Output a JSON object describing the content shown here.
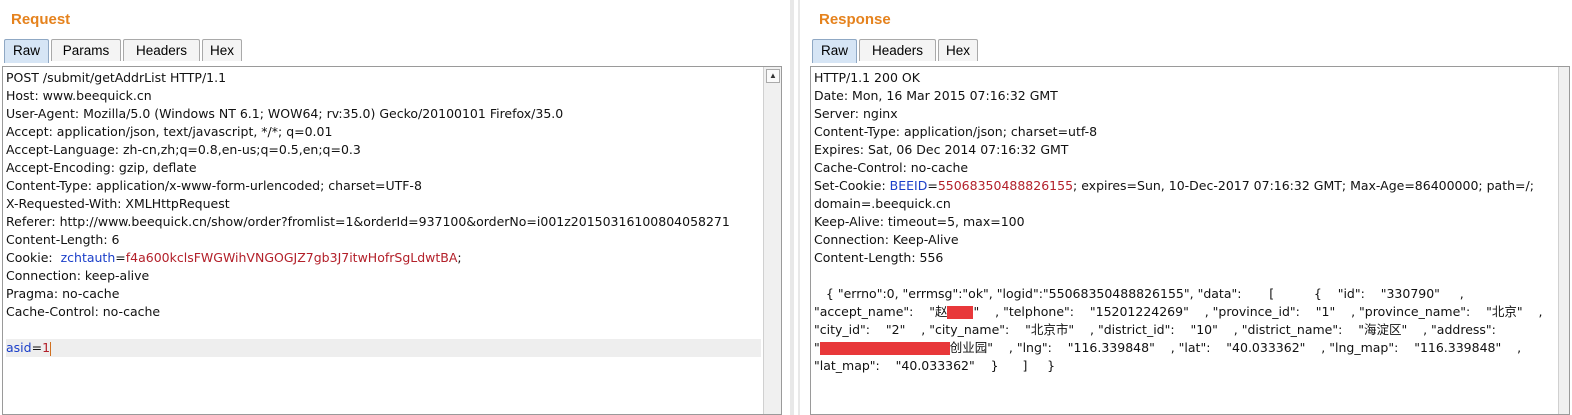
{
  "request": {
    "title": "Request",
    "tabs": [
      "Raw",
      "Params",
      "Headers",
      "Hex"
    ],
    "lines": [
      "POST /submit/getAddrList HTTP/1.1",
      "Host: www.beequick.cn",
      "User-Agent: Mozilla/5.0 (Windows NT 6.1; WOW64; rv:35.0) Gecko/20100101 Firefox/35.0",
      "Accept: application/json, text/javascript, */*; q=0.01",
      "Accept-Language: zh-cn,zh;q=0.8,en-us;q=0.5,en;q=0.3",
      "Accept-Encoding: gzip, deflate",
      "Content-Type: application/x-www-form-urlencoded; charset=UTF-8",
      "X-Requested-With: XMLHttpRequest",
      "Referer: http://www.beequick.cn/show/order?fromlist=1&orderId=937100&orderNo=i001z20150316100804058271",
      "Content-Length: 6"
    ],
    "cookie_prefix": "Cookie:  ",
    "cookie_name": "zchtauth",
    "cookie_eq": "=",
    "cookie_value": "f4a600kclsFWGWihVNGOGJZ7gb3J7itwHofrSgLdwtBA",
    "cookie_suffix": ";",
    "lines2": [
      "Connection: keep-alive",
      "Pragma: no-cache",
      "Cache-Control: no-cache"
    ],
    "body_name": "asid",
    "body_eq": "=",
    "body_value": "1"
  },
  "response": {
    "title": "Response",
    "tabs": [
      "Raw",
      "Headers",
      "Hex"
    ],
    "lines": [
      "HTTP/1.1 200 OK",
      "Date: Mon, 16 Mar 2015 07:16:32 GMT",
      "Server: nginx",
      "Content-Type: application/json; charset=utf-8",
      "Expires: Sat, 06 Dec 2014 07:16:32 GMT",
      "Cache-Control: no-cache"
    ],
    "setcookie_prefix": "Set-Cookie: ",
    "setcookie_name": "BEEID",
    "setcookie_eq": "=",
    "setcookie_value": "55068350488826155",
    "setcookie_rest": "; expires=Sun, 10-Dec-2017 07:16:32 GMT; Max-Age=86400000; path=/;",
    "lines2": [
      "domain=.beequick.cn",
      "Keep-Alive: timeout=5, max=100",
      "Connection: Keep-Alive",
      "Content-Length: 556"
    ],
    "body": {
      "l1": "   { \"errno\":0, \"errmsg\":\"ok\", \"logid\":\"55068350488826155\", \"data\":       [          {    \"id\":    \"330790\"     ,",
      "l2a": "\"accept_name\":    \"赵",
      "l2b": "\"    , \"telphone\":    \"15201224269\"    , \"province_id\":    \"1\"    , \"province_name\":    \"北京\"    ,",
      "l3": "\"city_id\":    \"2\"    , \"city_name\":    \"北京市\"    , \"district_id\":    \"10\"    , \"district_name\":    \"海淀区\"    , \"address\":",
      "l4a": "\"",
      "l4b": "创业园\"    , \"lng\":    \"116.339848\"    , \"lat\":    \"40.033362\"    , \"lng_map\":    \"116.339848\"    ,",
      "l5": "\"lat_map\":    \"40.033362\"    }      ]     }"
    }
  },
  "colors": {
    "title": "#e5821d",
    "key": "#1a3ec9",
    "value": "#b3202a",
    "redaction": "#e8383a",
    "active_tab": "#d6e5f5"
  }
}
